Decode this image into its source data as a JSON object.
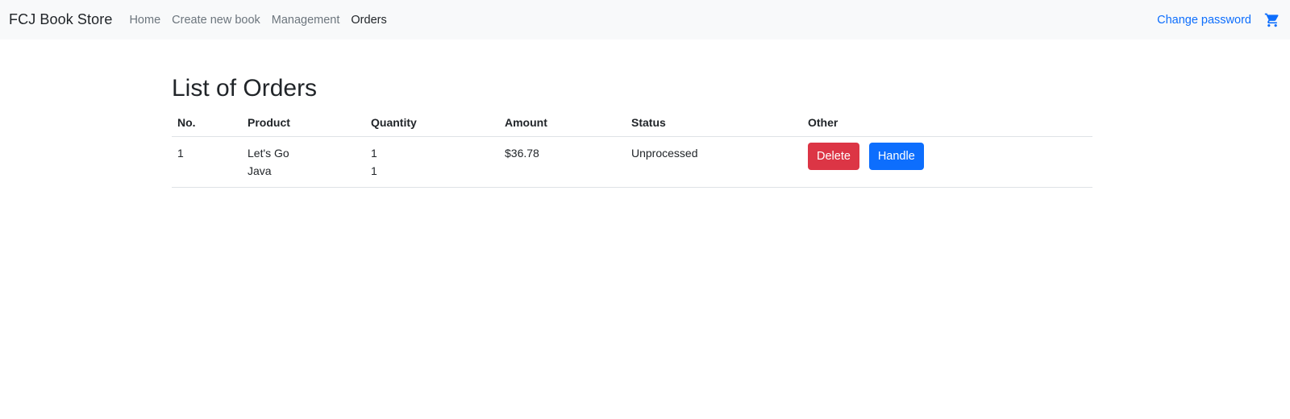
{
  "navbar": {
    "brand": "FCJ Book Store",
    "links": [
      "Home",
      "Create new book",
      "Management",
      "Orders"
    ],
    "active": "Orders",
    "change_password": "Change password",
    "cart_icon": "shopping-cart-icon",
    "accent_color": "#0d6efd"
  },
  "page": {
    "title": "List of Orders"
  },
  "table": {
    "headers": [
      "No.",
      "Product",
      "Quantity",
      "Amount",
      "Status",
      "Other"
    ],
    "rows": [
      {
        "no": "1",
        "products": [
          "Let's Go",
          "Java"
        ],
        "quantities": [
          "1",
          "1"
        ],
        "amount": "$36.78",
        "status": "Unprocessed",
        "actions": {
          "delete": "Delete",
          "handle": "Handle"
        }
      }
    ]
  },
  "colors": {
    "danger": "#dc3545",
    "primary": "#0d6efd"
  }
}
